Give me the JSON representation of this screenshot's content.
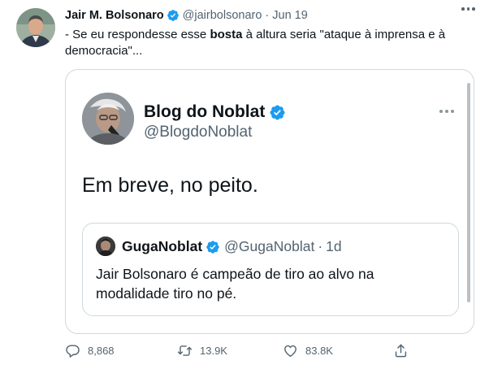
{
  "tweet": {
    "author_name": "Jair M. Bolsonaro",
    "handle": "@jairbolsonaro",
    "separator": "·",
    "time": "Jun 19",
    "text_before": "- Se eu respondesse esse ",
    "text_bold": "bosta",
    "text_after": " à altura seria \"ataque à imprensa e à democracia\"...",
    "icons": {
      "verified": "verified-badge-icon",
      "more": "more-options-icon"
    }
  },
  "embed": {
    "author_name": "Blog do Noblat",
    "handle": "@BlogdoNoblat",
    "text": "Em breve, no peito.",
    "quote": {
      "author_name": "GugaNoblat",
      "handle": "@GugaNoblat",
      "separator": "·",
      "time": "1d",
      "text": "Jair Bolsonaro é campeão de tiro ao alvo na modalidade tiro no pé."
    }
  },
  "actions": {
    "reply_count": "8,868",
    "retweet_count": "13.9K",
    "like_count": "83.8K",
    "icons": [
      "reply-icon",
      "retweet-icon",
      "like-icon",
      "share-icon"
    ]
  },
  "colors": {
    "verified_blue": "#1d9bf0",
    "text_primary": "#0f1419",
    "text_secondary": "#536471",
    "border": "#cfd9de"
  }
}
